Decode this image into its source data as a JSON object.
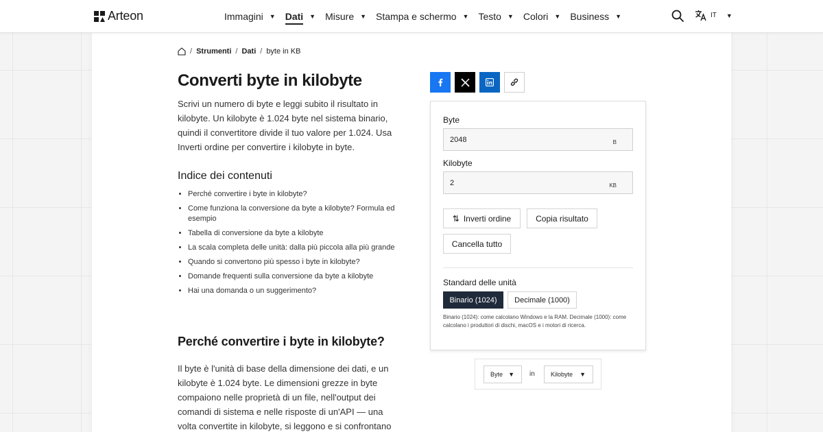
{
  "header": {
    "brand": "Arteon",
    "nav": [
      {
        "label": "Immagini",
        "active": false
      },
      {
        "label": "Dati",
        "active": true
      },
      {
        "label": "Misure",
        "active": false
      },
      {
        "label": "Stampa e schermo",
        "active": false
      },
      {
        "label": "Testo",
        "active": false
      },
      {
        "label": "Colori",
        "active": false
      },
      {
        "label": "Business",
        "active": false
      }
    ],
    "caret": "▼",
    "language": "IT"
  },
  "breadcrumb": {
    "items": [
      "Strumenti",
      "Dati"
    ],
    "current": "byte in KB",
    "separator": "/"
  },
  "article": {
    "title": "Converti byte in kilobyte",
    "intro": "Scrivi un numero di byte e leggi subito il risultato in kilobyte. Un kilobyte è 1.024 byte nel sistema binario, quindi il convertitore divide il tuo valore per 1.024. Usa Inverti ordine per convertire i kilobyte in byte.",
    "toc_title": "Indice dei contenuti",
    "toc": [
      "Perché convertire i byte in kilobyte?",
      "Come funziona la conversione da byte a kilobyte? Formula ed esempio",
      "Tabella di conversione da byte a kilobyte",
      "La scala completa delle unità: dalla più piccola alla più grande",
      "Quando si convertono più spesso i byte in kilobyte?",
      "Domande frequenti sulla conversione da byte a kilobyte",
      "Hai una domanda o un suggerimento?"
    ],
    "section_title": "Perché convertire i byte in kilobyte?",
    "section_text": "Il byte è l'unità di base della dimensione dei dati, e un kilobyte è 1.024 byte. Le dimensioni grezze in byte compaiono nelle proprietà di un file, nell'output dei comandi di sistema e nelle risposte di un'API — una volta convertite in kilobyte, si leggono e si confrontano"
  },
  "share": {
    "icons": [
      "facebook-icon",
      "x-icon",
      "linkedin-icon",
      "link-icon"
    ],
    "colors": {
      "facebook": "#1877f2",
      "x": "#000000",
      "linkedin": "#0a66c2"
    }
  },
  "converter": {
    "input_label": "Byte",
    "input_value": "2048",
    "input_unit": "B",
    "output_label": "Kilobyte",
    "output_value": "2",
    "output_unit": "KB",
    "swap_icon": "⇅",
    "swap_label": "Inverti ordine",
    "copy_label": "Copia risultato",
    "clear_label": "Cancella tutto",
    "standard_title": "Standard delle unità",
    "standard_binary": "Binario (1024)",
    "standard_decimal": "Decimale (1000)",
    "standard_selected": "binary",
    "standard_note": "Binario (1024): come calcolano Windows e la RAM. Decimale (1000): come calcolano i produttori di dischi, macOS e i motori di ricerca."
  },
  "unit_selector": {
    "from": "Byte",
    "connector": "in",
    "to": "Kilobyte",
    "caret": "▼"
  },
  "colors": {
    "accent_dark": "#1f2a3a",
    "text": "#1f1f1f"
  }
}
